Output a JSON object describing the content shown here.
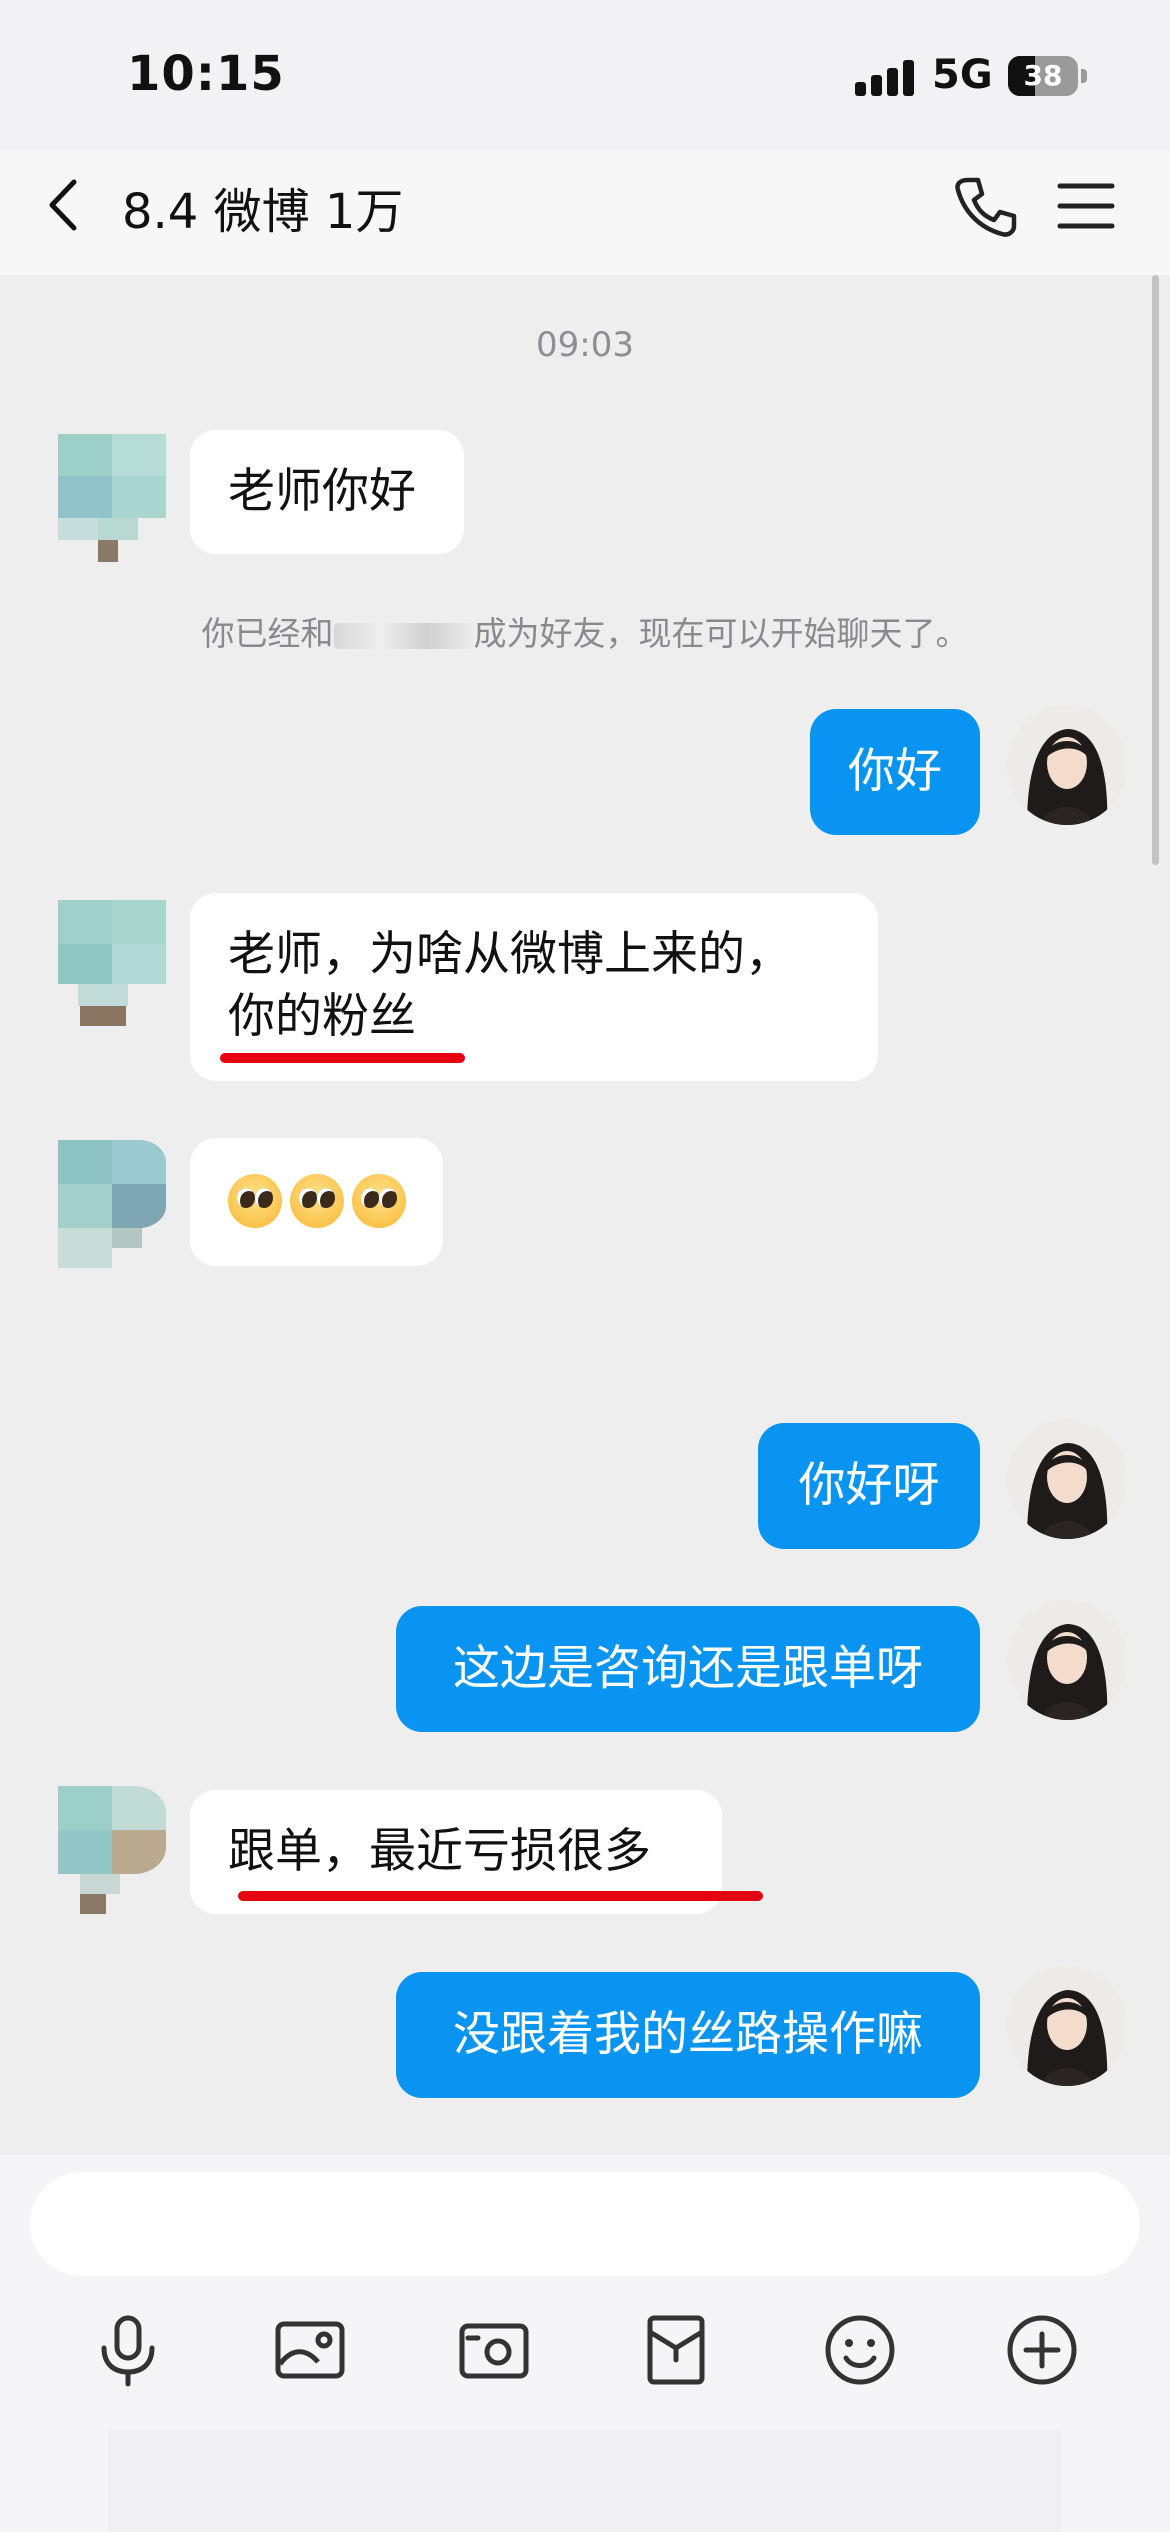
{
  "status_bar": {
    "time": "10:15",
    "network": "5G",
    "battery": "38",
    "battery_level": 0.38
  },
  "header": {
    "title": "8.4 微博 1万"
  },
  "chat": {
    "timestamp": "09:03",
    "system_message": {
      "before": "你已经和",
      "after": "成为好友，现在可以开始聊天了。"
    },
    "messages": [
      {
        "side": "in",
        "text": "老师你好"
      },
      {
        "side": "out",
        "text": "你好"
      },
      {
        "side": "in",
        "line1": "老师，为啥从微博上来的，",
        "line2": "你的粉丝"
      },
      {
        "side": "in",
        "emoji": [
          "pleading-face",
          "pleading-face",
          "pleading-face"
        ]
      },
      {
        "side": "out",
        "text": "你好呀"
      },
      {
        "side": "out",
        "text": "这边是咨询还是跟单呀"
      },
      {
        "side": "in",
        "text": "跟单，最近亏损很多"
      },
      {
        "side": "out",
        "text": "没跟着我的丝路操作嘛"
      }
    ]
  },
  "colors": {
    "out_bubble": "#0a94f1",
    "underline": "#e60012"
  },
  "icons": [
    "back-icon",
    "phone-icon",
    "menu-icon",
    "microphone-icon",
    "image-icon",
    "camera-icon",
    "red-packet-icon",
    "emoji-icon",
    "plus-icon"
  ]
}
